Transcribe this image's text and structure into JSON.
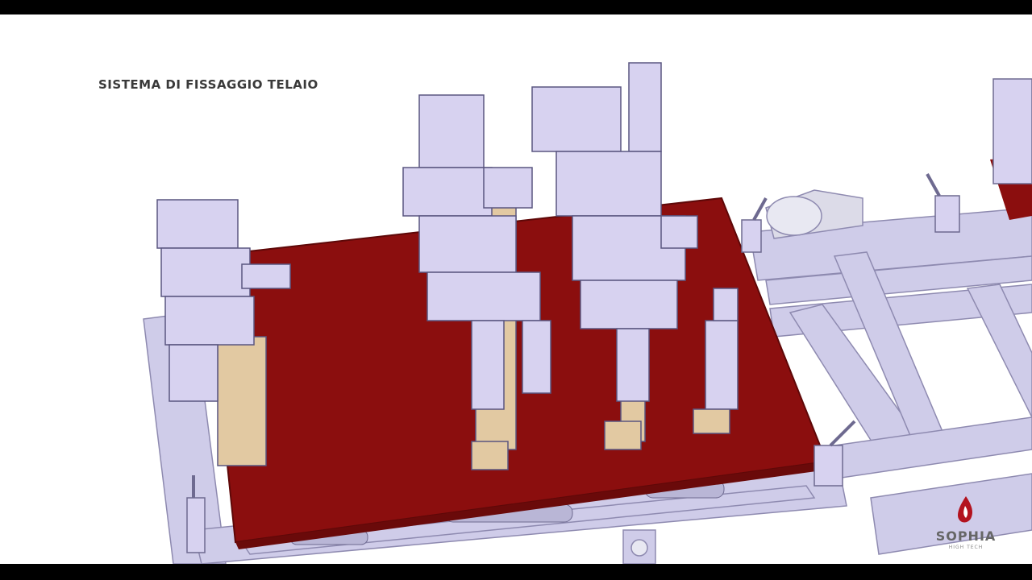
{
  "caption": "SISTEMA DI FISSAGGIO TELAIO",
  "logo": {
    "name": "SOPHIA",
    "tagline": "HIGH TECH"
  },
  "colors": {
    "plate": "#8b0e0e",
    "frame": "#c9c6e6",
    "frame_edge": "#8e8ab0",
    "fixture": "#d7d2f0",
    "wood": "#e2c9a2",
    "background": "#ffffff"
  }
}
